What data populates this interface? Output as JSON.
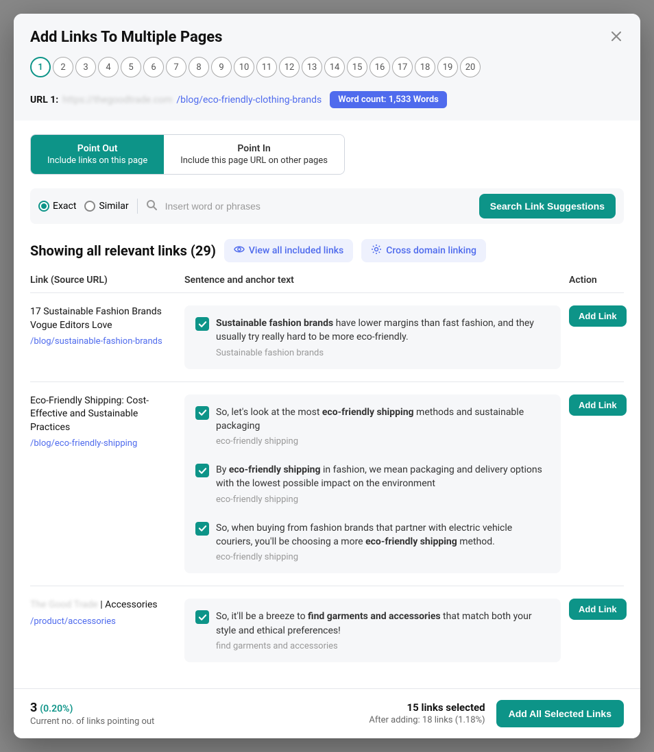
{
  "title": "Add Links To Multiple Pages",
  "steps": [
    "1",
    "2",
    "3",
    "4",
    "5",
    "6",
    "7",
    "8",
    "9",
    "10",
    "11",
    "12",
    "13",
    "14",
    "15",
    "16",
    "17",
    "18",
    "19",
    "20"
  ],
  "activeStep": 0,
  "url": {
    "label": "URL 1:",
    "host": "https://thegoodtrade.com",
    "path": "/blog/eco-friendly-clothing-brands"
  },
  "wordCount": "Word count: 1,533 Words",
  "tabs": {
    "out": {
      "title": "Point Out",
      "sub": "Include links on this page"
    },
    "in": {
      "title": "Point In",
      "sub": "Include this page URL on other pages"
    }
  },
  "search": {
    "exact": "Exact",
    "similar": "Similar",
    "placeholder": "Insert word or phrases",
    "button": "Search Link Suggestions"
  },
  "results": {
    "heading": "Showing all relevant links (29)",
    "chip1": "View all included links",
    "chip2": "Cross domain linking",
    "colLink": "Link (Source URL)",
    "colSent": "Sentence and anchor text",
    "colAct": "Action"
  },
  "addLinkLabel": "Add Link",
  "rows": [
    {
      "title": "17 Sustainable Fashion Brands Vogue Editors Love",
      "url": "/blog/sustainable-fashion-brands",
      "blurPrefix": "",
      "sentences": [
        {
          "html": "<b>Sustainable fashion brands</b> have lower margins than fast fashion, and they usually try really hard to be more eco-friendly.",
          "anchor": "Sustainable fashion brands"
        }
      ]
    },
    {
      "title": "Eco-Friendly Shipping: Cost-Effective and Sustainable Practices",
      "url": "/blog/eco-friendly-shipping",
      "blurPrefix": "",
      "sentences": [
        {
          "html": "So, let's look at the most <b>eco-friendly shipping</b> methods and sustainable packaging",
          "anchor": "eco-friendly shipping"
        },
        {
          "html": "By <b>eco-friendly shipping</b> in fashion, we mean packaging and delivery options with the lowest possible impact on the environment",
          "anchor": "eco-friendly shipping"
        },
        {
          "html": "So, when buying from fashion brands that partner with electric vehicle couriers, you'll be choosing a more <b>eco-friendly shipping</b> method.",
          "anchor": "eco-friendly shipping"
        }
      ]
    },
    {
      "title": " | Accessories",
      "url": "/product/accessories",
      "blurPrefix": "The Good Trade",
      "sentences": [
        {
          "html": "So, it'll be a breeze to <b>find garments and accessories</b> that match both your style and ethical preferences!",
          "anchor": "find garments and accessories"
        }
      ]
    }
  ],
  "footer": {
    "count": "3",
    "pct": "(0.20%)",
    "sub": "Current no. of links pointing out",
    "selected": "15 links selected",
    "after": "After adding: 18 links (1.18%)",
    "addAll": "Add All Selected Links"
  }
}
